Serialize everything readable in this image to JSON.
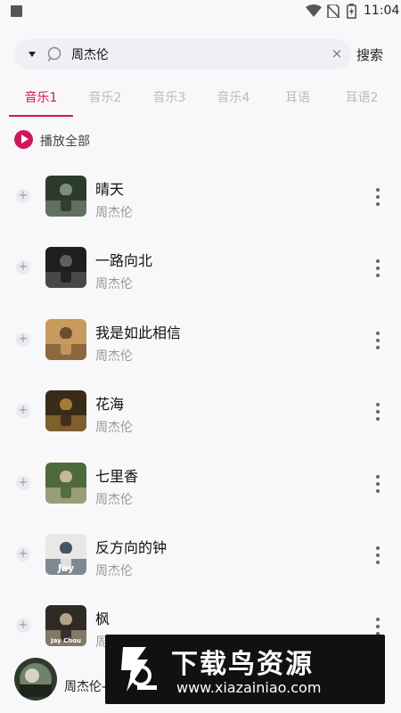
{
  "status_bar": {
    "time": "11:04"
  },
  "search": {
    "value": "周杰伦",
    "button_label": "搜索"
  },
  "tabs": [
    {
      "label": "音乐1",
      "active": true
    },
    {
      "label": "音乐2",
      "active": false
    },
    {
      "label": "音乐3",
      "active": false
    },
    {
      "label": "音乐4",
      "active": false
    },
    {
      "label": "耳语",
      "active": false
    },
    {
      "label": "耳语2",
      "active": false
    }
  ],
  "play_all_label": "播放全部",
  "songs": [
    {
      "title": "晴天",
      "artist": "周杰伦",
      "cover_colors": [
        "#2d3b2c",
        "#8aa08a"
      ]
    },
    {
      "title": "一路向北",
      "artist": "周杰伦",
      "cover_colors": [
        "#1e1e1e",
        "#6b6b6b"
      ]
    },
    {
      "title": "我是如此相信",
      "artist": "周杰伦",
      "cover_colors": [
        "#c89a5e",
        "#5a3f28"
      ]
    },
    {
      "title": "花海",
      "artist": "周杰伦",
      "cover_colors": [
        "#3a2a1a",
        "#b8893f"
      ]
    },
    {
      "title": "七里香",
      "artist": "周杰伦",
      "cover_colors": [
        "#4e6a3a",
        "#d9c7a8"
      ]
    },
    {
      "title": "反方向的钟",
      "artist": "周杰伦",
      "cover_colors": [
        "#e8e8e8",
        "#2a3a4a"
      ],
      "cover_text": "Jay"
    },
    {
      "title": "枫",
      "artist": "周杰伦",
      "cover_colors": [
        "#2f2a25",
        "#c9b79c"
      ],
      "cover_text": "Jay Chou"
    }
  ],
  "mini_player": {
    "text": "周杰伦-"
  },
  "watermark": {
    "title": "下载鸟资源",
    "url": "www.xiazainiao.com"
  },
  "colors": {
    "accent": "#d0165a",
    "background": "#f8f8fa"
  }
}
